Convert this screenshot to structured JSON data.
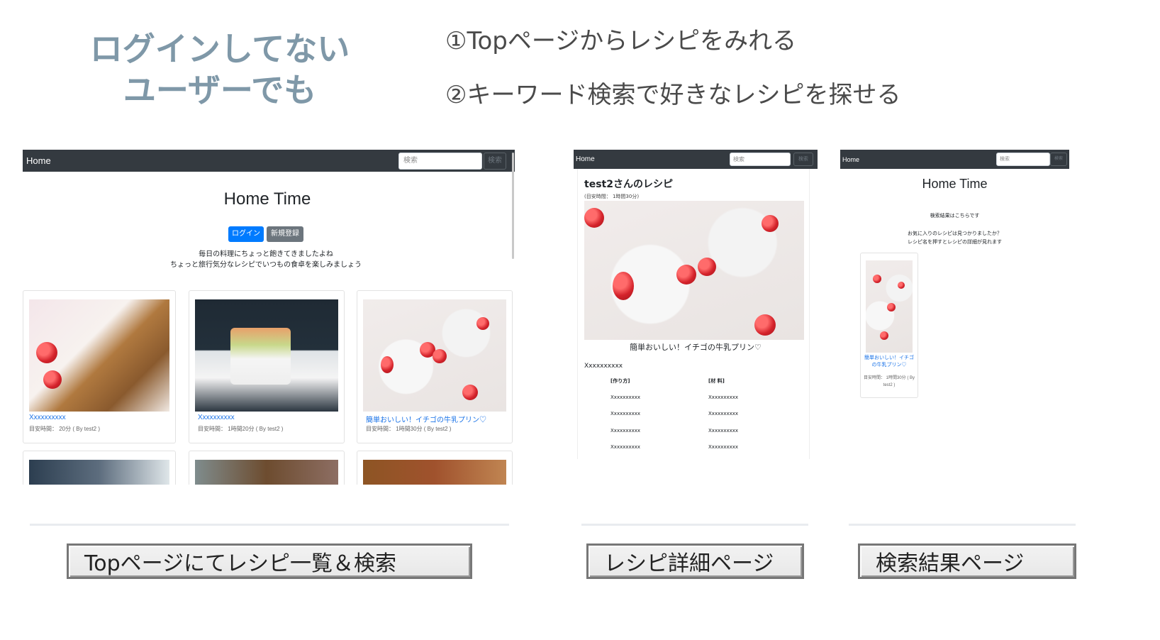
{
  "hero": {
    "line1": "ログインしてない",
    "line2": "ユーザーでも",
    "point1": "①Topページからレシピをみれる",
    "point2": "②キーワード検索で好きなレシピを探せる"
  },
  "top_page": {
    "nav_home": "Home",
    "search_placeholder": "検索",
    "search_button": "検索",
    "title": "Home Time",
    "login_button": "ログイン",
    "signup_button": "新規登録",
    "desc1": "毎日の料理にちょっと飽きてきましたよね",
    "desc2": "ちょっと旅行気分なレシピでいつもの食卓を楽しみましょう",
    "cards": [
      {
        "title": "Xxxxxxxxxx",
        "meta": "目安時間： 20分 ( By test2 )"
      },
      {
        "title": "Xxxxxxxxxx",
        "meta": "目安時間： 1時間20分 ( By test2 )"
      },
      {
        "title": "簡単おいしい！イチゴの牛乳プリン♡",
        "meta": "目安時間： 1時間30分 ( By test2 )"
      }
    ]
  },
  "detail_page": {
    "nav_home": "Home",
    "search_placeholder": "検索",
    "search_button": "検索",
    "heading": "test2さんのレシピ",
    "time": "(目安時間： 1時間30分)",
    "recipe_title": "簡単おいしい！イチゴの牛乳プリン♡",
    "description": "Xxxxxxxxxx",
    "steps_header": "[作り方]",
    "ingredients_header": "[材 料]",
    "steps": [
      "Xxxxxxxxxx",
      "Xxxxxxxxxx",
      "Xxxxxxxxxx",
      "Xxxxxxxxxx"
    ],
    "ingredients": [
      "Xxxxxxxxxx",
      "Xxxxxxxxxx",
      "Xxxxxxxxxx",
      "Xxxxxxxxxx"
    ]
  },
  "search_page": {
    "nav_home": "Home",
    "search_placeholder": "検索",
    "search_button": "検索",
    "title": "Home Time",
    "result_heading": "検索結果はこちらです",
    "hint1": "お気に入りのレシピは見つかりましたか？",
    "hint2": "レシピ名を押すとレシピの詳細が見れます",
    "card_title1": "簡単おいしい！イチゴ",
    "card_title2": "の牛乳プリン♡",
    "card_meta1": "目安時間： 1時間30分 ( By",
    "card_meta2": "test2 )"
  },
  "labels": {
    "top": "Topページにてレシピ一覧＆検索",
    "detail": "レシピ詳細ページ",
    "search": "検索結果ページ"
  }
}
